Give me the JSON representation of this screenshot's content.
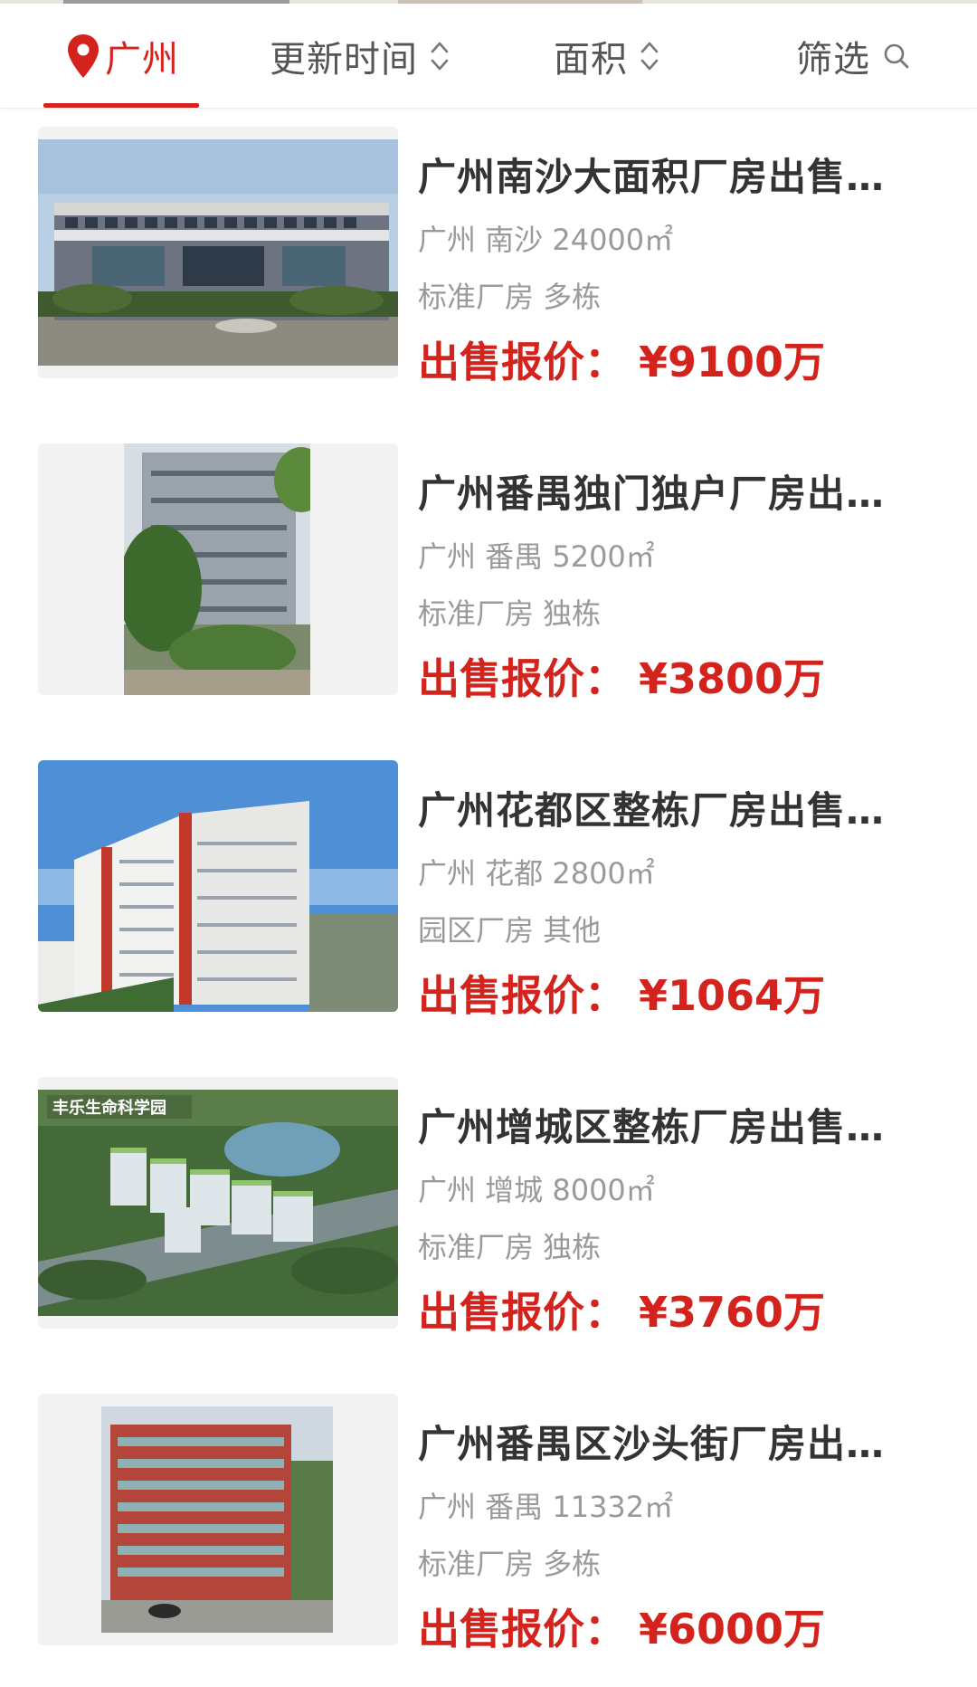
{
  "filter_bar": {
    "city": "广州",
    "update_time": "更新时间",
    "area": "面积",
    "filter": "筛选"
  },
  "colors": {
    "accent": "#d4231d",
    "title": "#333333",
    "meta": "#9a9a9a"
  },
  "listings": [
    {
      "title": "广州南沙大面积厂房出售…",
      "location": "广州 南沙 24000㎡",
      "tags": "标准厂房 多栋",
      "price_label": "出售报价：",
      "price": "¥9100万"
    },
    {
      "title": "广州番禺独门独户厂房出…",
      "location": "广州 番禺 5200㎡",
      "tags": "标准厂房 独栋",
      "price_label": "出售报价：",
      "price": "¥3800万"
    },
    {
      "title": "广州花都区整栋厂房出售…",
      "location": "广州 花都 2800㎡",
      "tags": "园区厂房 其他",
      "price_label": "出售报价：",
      "price": "¥1064万"
    },
    {
      "title": "广州增城区整栋厂房出售…",
      "location": "广州 增城 8000㎡",
      "tags": "标准厂房 独栋",
      "price_label": "出售报价：",
      "price": "¥3760万",
      "image_caption": "丰乐生命科学园"
    },
    {
      "title": "广州番禺区沙头街厂房出…",
      "location": "广州 番禺 11332㎡",
      "tags": "标准厂房 多栋",
      "price_label": "出售报价：",
      "price": "¥6000万"
    }
  ]
}
